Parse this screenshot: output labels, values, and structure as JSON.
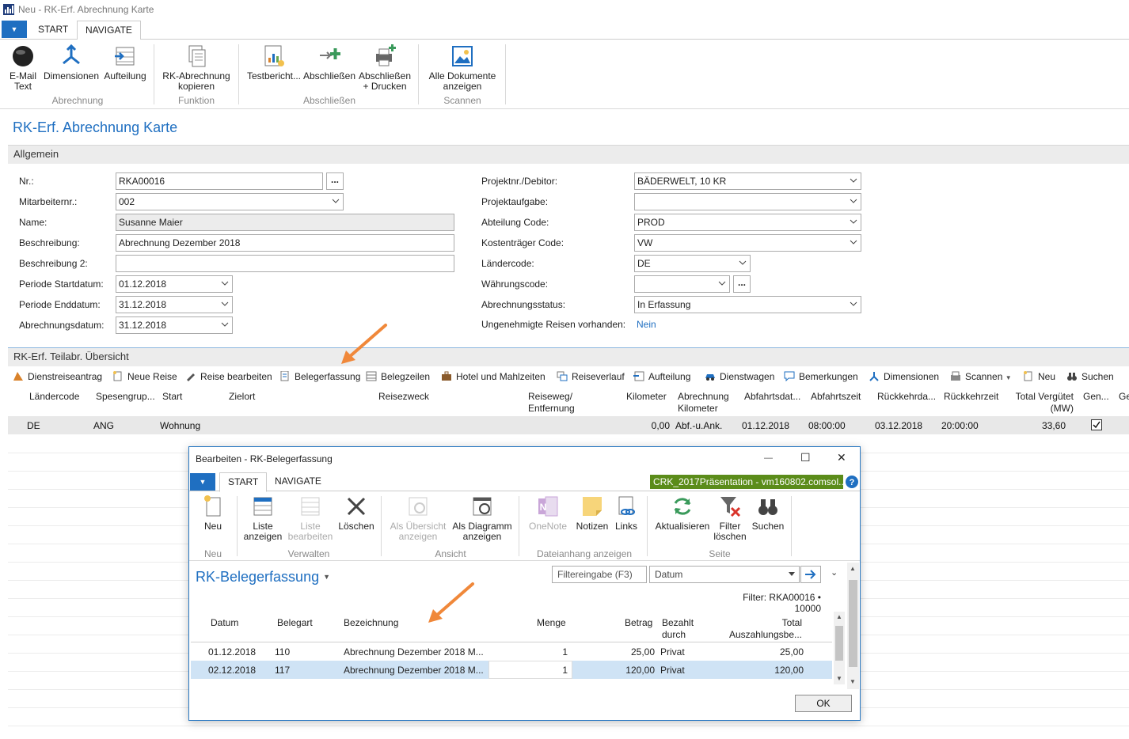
{
  "window": {
    "title": "Neu - RK-Erf. Abrechnung Karte"
  },
  "tabs": {
    "start": "START",
    "navigate": "NAVIGATE"
  },
  "ribbon": {
    "email_label": "E-Mail",
    "email_label2": "Text",
    "dimensionen": "Dimensionen",
    "aufteilung": "Aufteilung",
    "group_abrechnung": "Abrechnung",
    "kopieren_label": "RK-Abrechnung",
    "kopieren_label2": "kopieren",
    "group_funktion": "Funktion",
    "testbericht": "Testbericht...",
    "abschliessen": "Abschließen",
    "abschl_drucken": "Abschließen",
    "abschl_drucken2": "+ Drucken",
    "group_abschliessen": "Abschließen",
    "alle_dok": "Alle Dokumente",
    "alle_dok2": "anzeigen",
    "group_scannen": "Scannen"
  },
  "page": {
    "title": "RK-Erf. Abrechnung Karte"
  },
  "general": {
    "section": "Allgemein",
    "nr_label": "Nr.:",
    "nr": "RKA00016",
    "mitarbeiter_label": "Mitarbeiternr.:",
    "mitarbeiter": "002",
    "name_label": "Name:",
    "name": "Susanne Maier",
    "beschreibung_label": "Beschreibung:",
    "beschreibung": "Abrechnung Dezember 2018",
    "beschreibung2_label": "Beschreibung 2:",
    "beschreibung2": "",
    "start_label": "Periode Startdatum:",
    "start": "01.12.2018",
    "end_label": "Periode Enddatum:",
    "end": "31.12.2018",
    "abrdatum_label": "Abrechnungsdatum:",
    "abrdatum": "31.12.2018",
    "projekt_label": "Projektnr./Debitor:",
    "projekt": "BÄDERWELT, 10 KR",
    "aufgabe_label": "Projektaufgabe:",
    "aufgabe": "",
    "abteilung_label": "Abteilung Code:",
    "abteilung": "PROD",
    "kostentraeger_label": "Kostenträger Code:",
    "kostentraeger": "VW",
    "laender_label": "Ländercode:",
    "laender": "DE",
    "waehrung_label": "Währungscode:",
    "waehrung": "",
    "status_label": "Abrechnungsstatus:",
    "status": "In Erfassung",
    "ungenehmigt_label": "Ungenehmigte Reisen vorhanden:",
    "ungenehmigt": "Nein"
  },
  "sub": {
    "section": "RK-Erf. Teilabr. Übersicht",
    "toolbar": [
      "Dienstreiseantrag",
      "Neue Reise",
      "Reise bearbeiten",
      "Belegerfassung",
      "Belegzeilen",
      "Hotel und Mahlzeiten",
      "Reiseverlauf",
      "Aufteilung",
      "Dienstwagen",
      "Bemerkungen",
      "Dimensionen",
      "Scannen",
      "Neu",
      "Suchen"
    ],
    "headers": {
      "laender": "Ländercode",
      "spesen": "Spesengrup...",
      "start": "Start",
      "zielort": "Zielort",
      "zweck": "Reisezweck",
      "weg1": "Reiseweg/",
      "weg2": "Entfernung",
      "km": "Kilometer",
      "abr1": "Abrechnung",
      "abr2": "Kilometer",
      "abfdat": "Abfahrtsdat...",
      "abfzeit": "Abfahrtszeit",
      "rueckdat": "Rückkehrda...",
      "rueckzeit": "Rückkehrzeit",
      "total1": "Total Vergütet",
      "total2": "(MW)",
      "gen": "Gen...",
      "ge": "Ge"
    },
    "row": {
      "laender": "DE",
      "spesen": "ANG",
      "start": "Wohnung",
      "km": "0,00",
      "abr": "Abf.-u.Ank.",
      "abfdat": "01.12.2018",
      "abfzeit": "08:00:00",
      "rueckdat": "03.12.2018",
      "rueckzeit": "20:00:00",
      "total": "33,60"
    }
  },
  "dialog": {
    "title": "Bearbeiten - RK-Belegerfassung",
    "tab_start": "START",
    "tab_navigate": "NAVIGATE",
    "company": "CRK_2017Präsentation - vm160802.comsol...",
    "ribbon": {
      "neu": "Neu",
      "group_neu": "Neu",
      "liste1": "Liste",
      "liste2": "anzeigen",
      "listeb1": "Liste",
      "listeb2": "bearbeiten",
      "loeschen": "Löschen",
      "group_verwalten": "Verwalten",
      "uebersicht1": "Als Übersicht",
      "uebersicht2": "anzeigen",
      "diagramm1": "Als Diagramm",
      "diagramm2": "anzeigen",
      "group_ansicht": "Ansicht",
      "onenote": "OneNote",
      "notizen": "Notizen",
      "links": "Links",
      "group_datei": "Dateianhang anzeigen",
      "aktualisieren": "Aktualisieren",
      "filter1": "Filter",
      "filter2": "löschen",
      "suchen": "Suchen",
      "group_seite": "Seite"
    },
    "page_title": "RK-Belegerfassung",
    "filter_placeholder": "Filtereingabe (F3)",
    "filter_field": "Datum",
    "filter_text": "Filter: RKA00016 • 10000",
    "headers": {
      "datum": "Datum",
      "belegart": "Belegart",
      "bezeichnung": "Bezeichnung",
      "menge": "Menge",
      "betrag": "Betrag",
      "bezahlt1": "Bezahlt",
      "bezahlt2": "durch",
      "total1": "Total",
      "total2": "Auszahlungsbe..."
    },
    "rows": [
      {
        "datum": "01.12.2018",
        "belegart": "110",
        "bezeichnung": "Abrechnung Dezember 2018 M...",
        "menge": "1",
        "betrag": "25,00",
        "bezahlt": "Privat",
        "total": "25,00"
      },
      {
        "datum": "02.12.2018",
        "belegart": "117",
        "bezeichnung": "Abrechnung Dezember 2018 M...",
        "menge": "1",
        "betrag": "120,00",
        "bezahlt": "Privat",
        "total": "120,00"
      }
    ],
    "ok": "OK"
  },
  "colors": {
    "accent": "#1f6fc1",
    "company_bg": "#5b8c1a",
    "arrow": "#f0883a",
    "selected_row": "#cfe3f5"
  }
}
